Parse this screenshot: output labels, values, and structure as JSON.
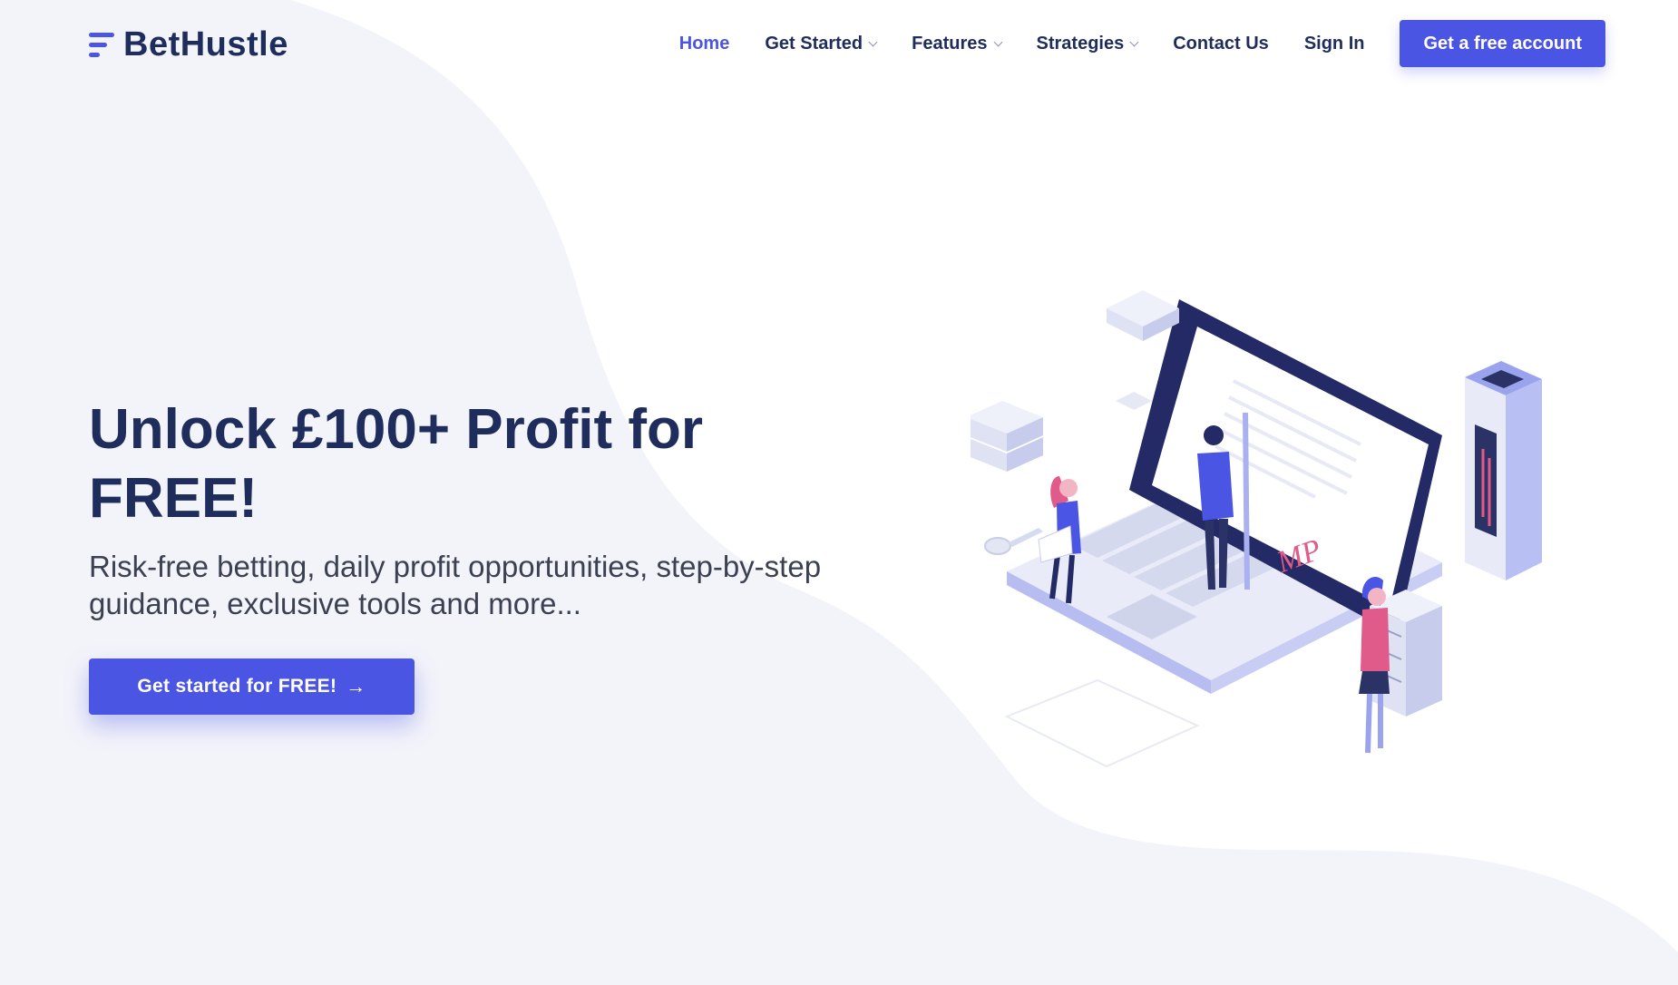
{
  "brand": {
    "name": "BetHustle",
    "accent": "#4b55e3",
    "navy": "#1f2d5c"
  },
  "nav": {
    "items": [
      {
        "label": "Home",
        "active": true,
        "dropdown": false
      },
      {
        "label": "Get Started",
        "active": false,
        "dropdown": true
      },
      {
        "label": "Features",
        "active": false,
        "dropdown": true
      },
      {
        "label": "Strategies",
        "active": false,
        "dropdown": true
      },
      {
        "label": "Contact Us",
        "active": false,
        "dropdown": false
      },
      {
        "label": "Sign In",
        "active": false,
        "dropdown": false
      }
    ],
    "cta": "Get a free account"
  },
  "hero": {
    "title": "Unlock £100+ Profit for FREE!",
    "subtitle": "Risk-free betting, daily profit opportunities, step-by-step guidance, exclusive tools and more...",
    "button": "Get started for FREE!",
    "button_icon": "arrow-right-icon"
  },
  "illustration": {
    "signature_text": "MP"
  }
}
